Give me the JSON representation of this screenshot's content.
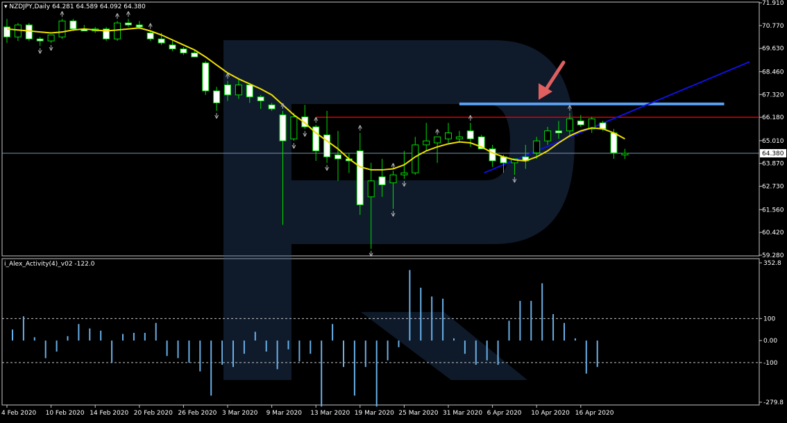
{
  "chart_data": [
    {
      "type": "candlestick",
      "symbol_header": "NZDJPY,Daily",
      "ohlc_header": [
        "64.281",
        "64.589",
        "64.092",
        "64.380"
      ],
      "current_price_label": "64.380",
      "current_price": 64.38,
      "ylim": [
        59.28,
        71.91
      ],
      "y_tick_labels": [
        "71.910",
        "70.770",
        "69.630",
        "68.460",
        "67.320",
        "66.180",
        "65.010",
        "63.870",
        "62.730",
        "61.560",
        "60.420",
        "59.280"
      ],
      "y_tick_values": [
        71.91,
        70.77,
        69.63,
        68.46,
        67.32,
        66.18,
        65.01,
        63.87,
        62.73,
        61.56,
        60.42,
        59.28
      ],
      "candles": [
        {
          "o": 70.7,
          "h": 71.1,
          "l": 69.9,
          "c": 70.2
        },
        {
          "o": 70.2,
          "h": 70.9,
          "l": 70.0,
          "c": 70.8
        },
        {
          "o": 70.8,
          "h": 70.9,
          "l": 70.0,
          "c": 70.1
        },
        {
          "o": 70.1,
          "h": 70.2,
          "l": 69.75,
          "c": 70.0
        },
        {
          "o": 70.0,
          "h": 70.3,
          "l": 69.9,
          "c": 70.3
        },
        {
          "o": 70.2,
          "h": 71.1,
          "l": 70.1,
          "c": 71.0
        },
        {
          "o": 71.0,
          "h": 71.1,
          "l": 70.5,
          "c": 70.6
        },
        {
          "o": 70.6,
          "h": 70.8,
          "l": 70.5,
          "c": 70.5
        },
        {
          "o": 70.5,
          "h": 70.7,
          "l": 70.4,
          "c": 70.6
        },
        {
          "o": 70.6,
          "h": 70.7,
          "l": 70.0,
          "c": 70.1
        },
        {
          "o": 70.1,
          "h": 71.0,
          "l": 70.0,
          "c": 70.9
        },
        {
          "o": 70.9,
          "h": 71.1,
          "l": 70.7,
          "c": 70.8
        },
        {
          "o": 70.8,
          "h": 71.0,
          "l": 70.6,
          "c": 70.7
        },
        {
          "o": 70.4,
          "h": 70.5,
          "l": 70.0,
          "c": 70.1
        },
        {
          "o": 70.1,
          "h": 70.4,
          "l": 69.8,
          "c": 69.9
        },
        {
          "o": 69.8,
          "h": 70.0,
          "l": 69.5,
          "c": 69.6
        },
        {
          "o": 69.6,
          "h": 69.7,
          "l": 69.3,
          "c": 69.4
        },
        {
          "o": 69.4,
          "h": 69.5,
          "l": 69.2,
          "c": 69.2
        },
        {
          "o": 68.9,
          "h": 69.0,
          "l": 67.3,
          "c": 67.5
        },
        {
          "o": 67.5,
          "h": 67.7,
          "l": 66.5,
          "c": 66.9
        },
        {
          "o": 67.8,
          "h": 68.0,
          "l": 67.0,
          "c": 67.3
        },
        {
          "o": 67.3,
          "h": 68.1,
          "l": 67.1,
          "c": 67.8
        },
        {
          "o": 67.8,
          "h": 67.9,
          "l": 66.9,
          "c": 67.2
        },
        {
          "o": 67.2,
          "h": 67.3,
          "l": 66.6,
          "c": 67.0
        },
        {
          "o": 66.8,
          "h": 66.9,
          "l": 66.5,
          "c": 66.6
        },
        {
          "o": 66.3,
          "h": 66.5,
          "l": 60.8,
          "c": 65.0
        },
        {
          "o": 65.1,
          "h": 66.4,
          "l": 65.0,
          "c": 66.2
        },
        {
          "o": 66.2,
          "h": 66.8,
          "l": 65.6,
          "c": 65.7
        },
        {
          "o": 65.7,
          "h": 65.8,
          "l": 64.0,
          "c": 64.5
        },
        {
          "o": 65.3,
          "h": 66.5,
          "l": 63.9,
          "c": 64.2
        },
        {
          "o": 64.3,
          "h": 65.5,
          "l": 63.0,
          "c": 64.1
        },
        {
          "o": 64.1,
          "h": 64.4,
          "l": 63.4,
          "c": 64.0
        },
        {
          "o": 64.5,
          "h": 65.4,
          "l": 61.3,
          "c": 61.8
        },
        {
          "o": 62.2,
          "h": 63.9,
          "l": 59.6,
          "c": 63.0
        },
        {
          "o": 63.2,
          "h": 64.1,
          "l": 62.2,
          "c": 62.8
        },
        {
          "o": 62.9,
          "h": 63.5,
          "l": 61.6,
          "c": 63.3
        },
        {
          "o": 63.3,
          "h": 64.5,
          "l": 63.1,
          "c": 63.4
        },
        {
          "o": 63.4,
          "h": 65.2,
          "l": 63.3,
          "c": 64.8
        },
        {
          "o": 64.8,
          "h": 65.9,
          "l": 64.5,
          "c": 65.0
        },
        {
          "o": 64.9,
          "h": 65.2,
          "l": 63.9,
          "c": 65.2
        },
        {
          "o": 65.1,
          "h": 65.9,
          "l": 64.9,
          "c": 65.4
        },
        {
          "o": 65.1,
          "h": 65.5,
          "l": 64.9,
          "c": 65.2
        },
        {
          "o": 65.5,
          "h": 65.9,
          "l": 64.7,
          "c": 65.1
        },
        {
          "o": 65.2,
          "h": 65.3,
          "l": 64.6,
          "c": 64.6
        },
        {
          "o": 64.6,
          "h": 64.8,
          "l": 63.7,
          "c": 64.0
        },
        {
          "o": 64.2,
          "h": 64.3,
          "l": 63.4,
          "c": 63.9
        },
        {
          "o": 63.9,
          "h": 64.1,
          "l": 63.3,
          "c": 64.1
        },
        {
          "o": 64.2,
          "h": 64.8,
          "l": 63.6,
          "c": 64.0
        },
        {
          "o": 64.4,
          "h": 65.2,
          "l": 64.1,
          "c": 65.0
        },
        {
          "o": 65.0,
          "h": 65.7,
          "l": 64.8,
          "c": 65.5
        },
        {
          "o": 65.5,
          "h": 66.0,
          "l": 65.1,
          "c": 65.4
        },
        {
          "o": 65.5,
          "h": 66.4,
          "l": 65.2,
          "c": 66.1
        },
        {
          "o": 66.0,
          "h": 66.3,
          "l": 65.7,
          "c": 65.8
        },
        {
          "o": 65.6,
          "h": 66.2,
          "l": 65.4,
          "c": 66.1
        },
        {
          "o": 65.9,
          "h": 66.0,
          "l": 65.5,
          "c": 65.6
        },
        {
          "o": 65.4,
          "h": 65.6,
          "l": 64.1,
          "c": 64.4
        },
        {
          "o": 64.3,
          "h": 64.6,
          "l": 64.1,
          "c": 64.38
        }
      ],
      "moving_average": [
        70.6,
        70.55,
        70.5,
        70.45,
        70.4,
        70.45,
        70.55,
        70.6,
        70.55,
        70.5,
        70.55,
        70.6,
        70.65,
        70.5,
        70.3,
        70.05,
        69.8,
        69.55,
        69.2,
        68.8,
        68.4,
        68.1,
        67.85,
        67.6,
        67.3,
        66.8,
        66.3,
        65.9,
        65.4,
        65.0,
        64.6,
        64.1,
        63.7,
        63.55,
        63.55,
        63.6,
        63.8,
        64.2,
        64.5,
        64.7,
        64.85,
        64.95,
        64.9,
        64.7,
        64.4,
        64.2,
        64.05,
        64.0,
        64.2,
        64.5,
        64.9,
        65.25,
        65.5,
        65.65,
        65.6,
        65.4,
        65.1
      ],
      "horizontal_level_red": 66.18,
      "horizontal_level_blue": 66.85,
      "trendline_blue": {
        "start_bar": 44,
        "start_price": 63.4,
        "end_bar": 57,
        "end_price": 66.5
      },
      "fractals_up": [
        5,
        10,
        11,
        13,
        20,
        25,
        28,
        32,
        35,
        39,
        42,
        51
      ],
      "fractals_down": [
        3,
        4,
        19,
        26,
        27,
        29,
        33,
        35,
        36,
        46
      ],
      "dates_axis_labels": [
        "4 Feb 2020",
        "10 Feb 2020",
        "14 Feb 2020",
        "20 Feb 2020",
        "26 Feb 2020",
        "3 Mar 2020",
        "9 Mar 2020",
        "13 Mar 2020",
        "19 Mar 2020",
        "25 Mar 2020",
        "31 Mar 2020",
        "6 Apr 2020",
        "10 Apr 2020",
        "16 Apr 2020"
      ],
      "dates_axis_bar_index": [
        0,
        4,
        8,
        12,
        16,
        20,
        24,
        28,
        32,
        36,
        40,
        44,
        48,
        52
      ]
    },
    {
      "type": "bar",
      "indicator_label": "i_Alex_Activity(4)_v02 -122.0",
      "ylim": [
        -279.8,
        352.8
      ],
      "y_tick_labels": [
        "352.8",
        "100",
        "0.00",
        "-100",
        "-279.8"
      ],
      "y_tick_values": [
        352.8,
        100,
        0,
        -100,
        -279.8
      ],
      "reference_levels": [
        100,
        -100
      ],
      "values": [
        50,
        110,
        15,
        -80,
        -50,
        20,
        75,
        55,
        45,
        -100,
        30,
        35,
        35,
        80,
        -70,
        -80,
        -100,
        -140,
        -250,
        -110,
        -120,
        -60,
        40,
        -50,
        -130,
        -40,
        -95,
        -60,
        -300,
        75,
        -120,
        -250,
        -120,
        -300,
        -90,
        -30,
        320,
        240,
        200,
        190,
        10,
        -60,
        -110,
        -90,
        -110,
        90,
        180,
        180,
        260,
        120,
        80,
        10,
        -150,
        -120
      ]
    }
  ]
}
